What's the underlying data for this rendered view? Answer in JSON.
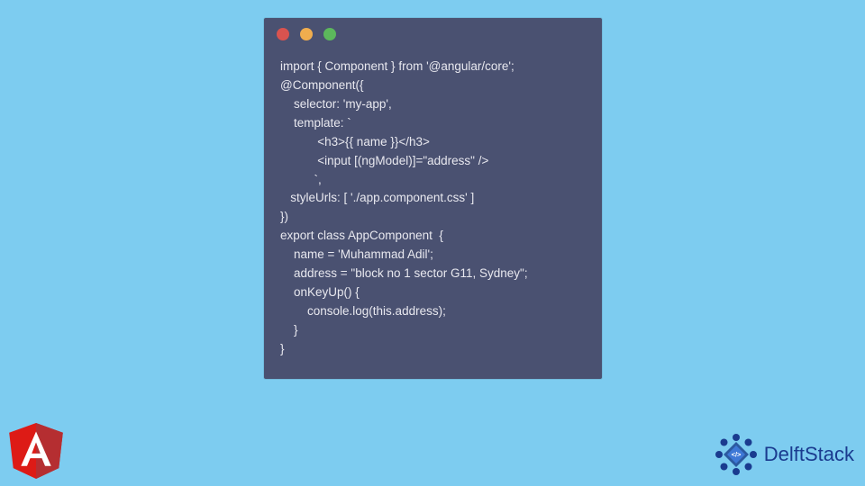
{
  "code_window": {
    "dots": [
      "red",
      "yellow",
      "green"
    ],
    "code": "import { Component } from '@angular/core';\n@Component({\n    selector: 'my-app',\n    template: `\n           <h3>{{ name }}</h3>\n           <input [(ngModel)]=\"address\" />\n          `,\n   styleUrls: [ './app.component.css' ]\n})\nexport class AppComponent  {\n    name = 'Muhammad Adil';\n    address = \"block no 1 sector G11, Sydney\";\n    onKeyUp() {\n        console.log(this.address);\n    }\n}"
  },
  "logos": {
    "angular_letter": "A",
    "delftstack_text": "DelftStack"
  },
  "colors": {
    "bg": "#7dccf0",
    "window_bg": "#4a5171",
    "code_text": "#e8e8ef",
    "dot_red": "#d9534f",
    "dot_yellow": "#f0ad4e",
    "dot_green": "#5cb85c",
    "angular_red": "#dd1b16",
    "angular_dark": "#b52e31",
    "delft_blue": "#1a3b8f",
    "delft_accent": "#2c5aa0"
  }
}
